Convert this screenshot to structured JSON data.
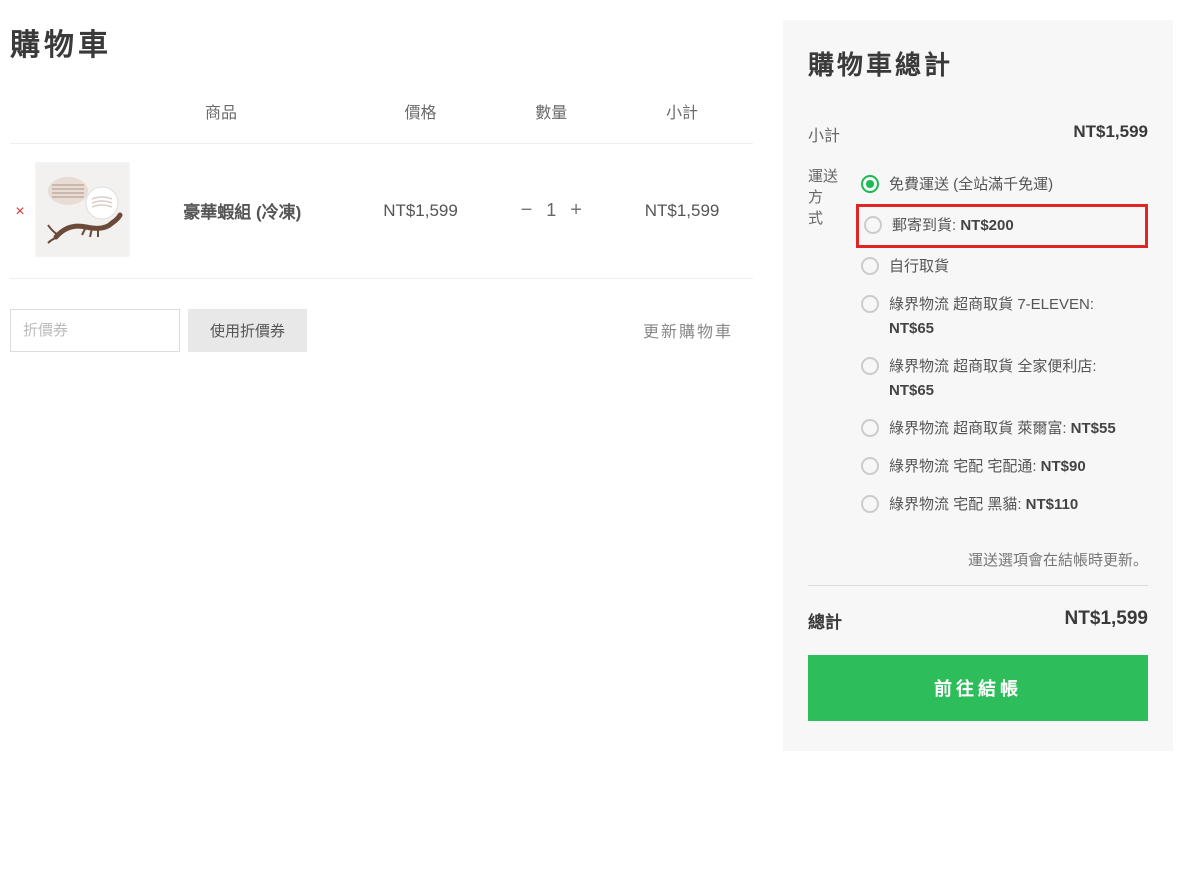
{
  "page_title": "購物車",
  "headers": {
    "product": "商品",
    "price": "價格",
    "qty": "數量",
    "subtotal": "小計"
  },
  "item": {
    "name": "豪華蝦組 (冷凍)",
    "price": "NT$1,599",
    "qty": "1",
    "subtotal": "NT$1,599"
  },
  "coupon": {
    "placeholder": "折價券",
    "apply": "使用折價券"
  },
  "update_cart": "更新購物車",
  "totals": {
    "title": "購物車總計",
    "subtotal_label": "小計",
    "subtotal_value": "NT$1,599",
    "shipping_label_1": "運送方",
    "shipping_label_2": "式",
    "options": [
      {
        "label": "免費運送 (全站滿千免運)",
        "price": "",
        "selected": true,
        "highlight": false
      },
      {
        "label": "郵寄到貨: ",
        "price": "NT$200",
        "selected": false,
        "highlight": true
      },
      {
        "label": "自行取貨",
        "price": "",
        "selected": false,
        "highlight": false
      },
      {
        "label": "綠界物流 超商取貨 7-ELEVEN: ",
        "price": "NT$65",
        "selected": false,
        "highlight": false
      },
      {
        "label": "綠界物流 超商取貨 全家便利店: ",
        "price": "NT$65",
        "selected": false,
        "highlight": false
      },
      {
        "label": "綠界物流 超商取貨 萊爾富: ",
        "price": "NT$55",
        "selected": false,
        "highlight": false
      },
      {
        "label": "綠界物流 宅配 宅配通: ",
        "price": "NT$90",
        "selected": false,
        "highlight": false
      },
      {
        "label": "綠界物流 宅配 黑貓: ",
        "price": "NT$110",
        "selected": false,
        "highlight": false
      }
    ],
    "shipping_note": "運送選項會在結帳時更新。",
    "total_label": "總計",
    "total_value": "NT$1,599",
    "checkout": "前往結帳"
  }
}
